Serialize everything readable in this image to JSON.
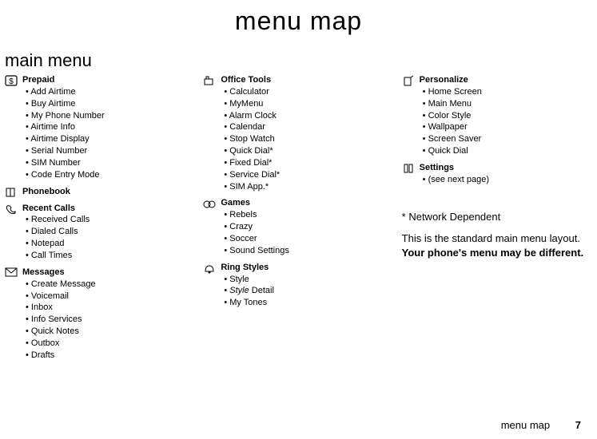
{
  "title": "menu map",
  "section": "main menu",
  "columns": [
    {
      "groups": [
        {
          "icon": "dollar-box-icon",
          "glyph": "dollar",
          "heading": "Prepaid",
          "items": [
            {
              "t": "Add Airtime"
            },
            {
              "t": "Buy Airtime"
            },
            {
              "t": "My Phone Number"
            },
            {
              "t": "Airtime Info"
            },
            {
              "t": "Airtime Display"
            },
            {
              "t": "Serial Number"
            },
            {
              "t": "SIM Number"
            },
            {
              "t": "Code Entry Mode"
            }
          ]
        },
        {
          "icon": "phonebook-icon",
          "glyph": "book",
          "heading": "Phonebook",
          "items": []
        },
        {
          "icon": "recent-calls-icon",
          "glyph": "phone",
          "heading": "Recent Calls",
          "items": [
            {
              "t": "Received Calls"
            },
            {
              "t": "Dialed Calls"
            },
            {
              "t": "Notepad"
            },
            {
              "t": "Call Times"
            }
          ]
        },
        {
          "icon": "messages-icon",
          "glyph": "envelope",
          "heading": "Messages",
          "items": [
            {
              "t": "Create Message"
            },
            {
              "t": "Voicemail"
            },
            {
              "t": "Inbox"
            },
            {
              "t": "Info Services"
            },
            {
              "t": "Quick Notes"
            },
            {
              "t": "Outbox"
            },
            {
              "t": "Drafts"
            }
          ]
        }
      ]
    },
    {
      "groups": [
        {
          "icon": "office-tools-icon",
          "glyph": "tools",
          "heading": "Office Tools",
          "items": [
            {
              "t": "Calculator"
            },
            {
              "t": "MyMenu"
            },
            {
              "t": "Alarm Clock"
            },
            {
              "t": "Calendar"
            },
            {
              "t": "Stop Watch"
            },
            {
              "t": "Quick Dial*"
            },
            {
              "t": "Fixed Dial*"
            },
            {
              "t": "Service Dial*"
            },
            {
              "t": "SIM App.*"
            }
          ]
        },
        {
          "icon": "games-icon",
          "glyph": "game",
          "heading": "Games",
          "items": [
            {
              "t": "Rebels"
            },
            {
              "t": "Crazy"
            },
            {
              "t": "Soccer"
            },
            {
              "t": "Sound Settings"
            }
          ]
        },
        {
          "icon": "ring-styles-icon",
          "glyph": "ring",
          "heading": "Ring Styles",
          "items": [
            {
              "t": "Style"
            },
            {
              "t": "Style Detail",
              "italicPrefix": "Style",
              "suffix": " Detail"
            },
            {
              "t": "My Tones"
            }
          ]
        }
      ]
    },
    {
      "groups": [
        {
          "icon": "personalize-icon",
          "glyph": "personalize",
          "heading": "Personalize",
          "items": [
            {
              "t": "Home Screen"
            },
            {
              "t": "Main Menu"
            },
            {
              "t": "Color Style"
            },
            {
              "t": "Wallpaper"
            },
            {
              "t": "Screen Saver"
            },
            {
              "t": "Quick Dial"
            }
          ]
        },
        {
          "icon": "settings-icon",
          "glyph": "settings",
          "heading": "Settings",
          "items": [
            {
              "t": "(see next page)"
            }
          ]
        }
      ],
      "note_star": "* Network Dependent",
      "layout_line": "This is the standard main menu layout.",
      "layout_bold": "Your phone's menu may be different."
    }
  ],
  "footer": {
    "label": "menu map",
    "page": "7"
  }
}
